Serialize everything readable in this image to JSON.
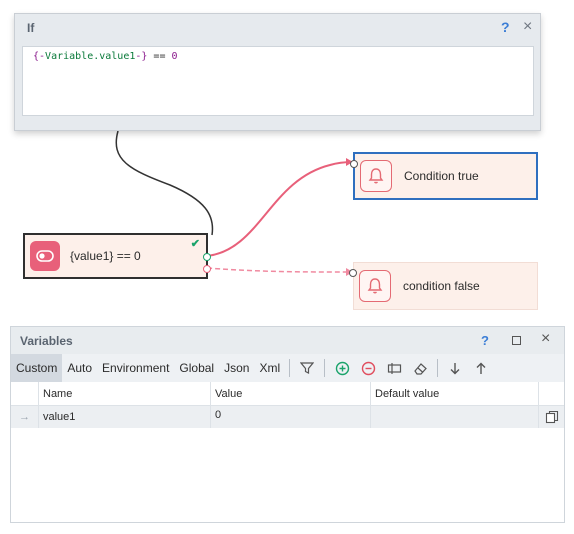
{
  "if_dialog": {
    "title": "If",
    "help_label": "?",
    "close_label": "×",
    "expression": {
      "brace_open": "{-",
      "variable": "Variable.value1",
      "brace_close": "-}",
      "operator": " == ",
      "number": "0"
    }
  },
  "nodes": {
    "condition": {
      "label": "{value1} == 0"
    },
    "true_branch": {
      "label": "Condition true"
    },
    "false_branch": {
      "label": "condition false"
    }
  },
  "colors": {
    "wire_true": "#e8607a",
    "wire_false": "#f08aa0",
    "wire_input": "#333333",
    "selected_border": "#2f6fbf",
    "check": "#1aa36b"
  },
  "variables_panel": {
    "title": "Variables",
    "help_label": "?",
    "close_label": "×",
    "tabs": [
      "Custom",
      "Auto",
      "Environment",
      "Global",
      "Json",
      "Xml"
    ],
    "active_tab": "Custom",
    "columns": [
      "Name",
      "Value",
      "Default value"
    ],
    "rows": [
      {
        "name": "value1",
        "value": "0",
        "default": ""
      }
    ]
  }
}
